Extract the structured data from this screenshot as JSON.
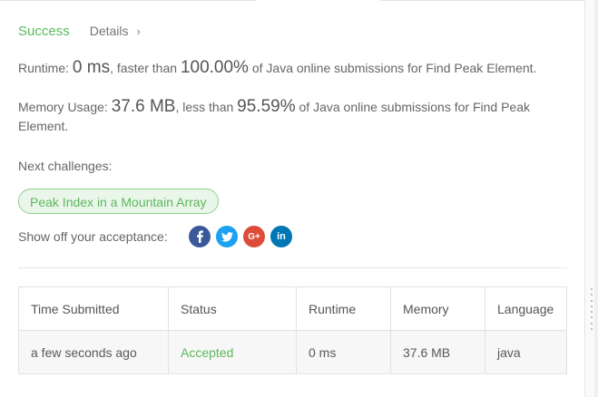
{
  "result": {
    "status": "Success",
    "details_label": "Details",
    "chevron_glyph": "›"
  },
  "runtime": {
    "label": "Runtime: ",
    "value": "0 ms",
    "comparison": ", faster than ",
    "percent": "100.00%",
    "suffix": " of Java online submissions for Find Peak Element."
  },
  "memory": {
    "label": "Memory Usage: ",
    "value": "37.6 MB",
    "comparison": ", less than ",
    "percent": "95.59%",
    "suffix": " of Java online submissions for Find Peak Element."
  },
  "next": {
    "label": "Next challenges:",
    "challenges": [
      "Peak Index in a Mountain Array"
    ]
  },
  "share": {
    "label": "Show off your acceptance:",
    "icons": [
      {
        "name": "facebook-icon",
        "glyph": "f"
      },
      {
        "name": "twitter-icon",
        "glyph": "🐦"
      },
      {
        "name": "google-plus-icon",
        "glyph": "G+"
      },
      {
        "name": "linkedin-icon",
        "glyph": "in"
      }
    ]
  },
  "table": {
    "columns": [
      "Time Submitted",
      "Status",
      "Runtime",
      "Memory",
      "Language"
    ],
    "rows": [
      {
        "time": "a few seconds ago",
        "status": "Accepted",
        "runtime": "0 ms",
        "memory": "37.6 MB",
        "language": "java"
      }
    ]
  },
  "colors": {
    "success": "#5cb85c",
    "pill_bg": "#eaf6ea",
    "facebook": "#3b5998",
    "twitter": "#1da1f2",
    "google_plus": "#dd4b39",
    "linkedin": "#0077b5"
  }
}
